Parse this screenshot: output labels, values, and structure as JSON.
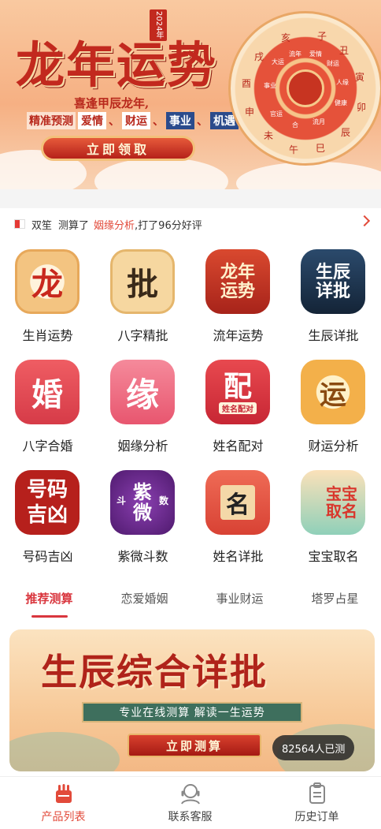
{
  "banner": {
    "title": "龙年运势",
    "year_badge": "2024年",
    "subtitle": "喜逢甲辰龙年,",
    "lead": "精准预测",
    "tags": [
      "爱情",
      "财运",
      "事业",
      "机遇"
    ],
    "cta": "立即领取",
    "zodiac": [
      "子",
      "丑",
      "寅",
      "卯",
      "辰",
      "巳",
      "午",
      "未",
      "申",
      "酉",
      "戌",
      "亥"
    ],
    "wheel_inner": [
      "大运",
      "流年",
      "爱情",
      "财运",
      "人缘",
      "健康",
      "官运",
      "流月",
      "事业",
      "合"
    ]
  },
  "notice": {
    "user": "双笙",
    "action": "测算了",
    "item": "姻缘分析",
    "result": ",打了96分好评"
  },
  "services": [
    {
      "label": "生肖运势",
      "glyph": "龙",
      "icon": "zodiac-dragon-icon",
      "color": "#f4c98b"
    },
    {
      "label": "八字精批",
      "glyph": "批",
      "icon": "bazi-scroll-icon",
      "color": "#f6d7a0"
    },
    {
      "label": "流年运势",
      "glyph": "龙年运势",
      "icon": "dragon-year-icon",
      "color": "#c73a2b"
    },
    {
      "label": "生辰详批",
      "glyph": "生辰详批",
      "icon": "birth-detail-icon",
      "color": "#1f3552"
    },
    {
      "label": "八字合婚",
      "glyph": "婚",
      "icon": "wedding-dress-icon",
      "color": "#e8505b"
    },
    {
      "label": "姻缘分析",
      "glyph": "缘",
      "icon": "marriage-fate-icon",
      "color": "#ef6f86"
    },
    {
      "label": "姓名配对",
      "glyph": "配",
      "icon": "name-match-icon",
      "color": "#d93a3f"
    },
    {
      "label": "财运分析",
      "glyph": "运",
      "icon": "wealth-coin-icon",
      "color": "#f3b04a"
    },
    {
      "label": "号码吉凶",
      "glyph": "号码吉凶",
      "icon": "number-luck-icon",
      "color": "#b6201c"
    },
    {
      "label": "紫微斗数",
      "glyph": "紫微",
      "icon": "ziwei-star-icon",
      "color": "#6a2a8c"
    },
    {
      "label": "姓名详批",
      "glyph": "名",
      "icon": "name-scroll-icon",
      "color": "#e4584a"
    },
    {
      "label": "宝宝取名",
      "glyph": "宝宝取名",
      "icon": "baby-name-icon",
      "color": "#7ec7b0"
    }
  ],
  "service_extra": {
    "name_match_caption": "姓名配对",
    "ziwei_small_1": "斗",
    "ziwei_small_2": "数"
  },
  "tabs": [
    "推荐测算",
    "恋爱婚姻",
    "事业财运",
    "塔罗占星"
  ],
  "featured": {
    "title": "生辰综合详批",
    "slogan": "专业在线测算  解读一生运势",
    "button": "立即测算",
    "count": "82564人已测"
  },
  "nav": [
    {
      "label": "产品列表",
      "icon": "product-list-icon"
    },
    {
      "label": "联系客服",
      "icon": "customer-service-icon"
    },
    {
      "label": "历史订单",
      "icon": "order-history-icon"
    }
  ],
  "colors": {
    "accent": "#e24a3a",
    "tab_active": "#d9363e"
  }
}
